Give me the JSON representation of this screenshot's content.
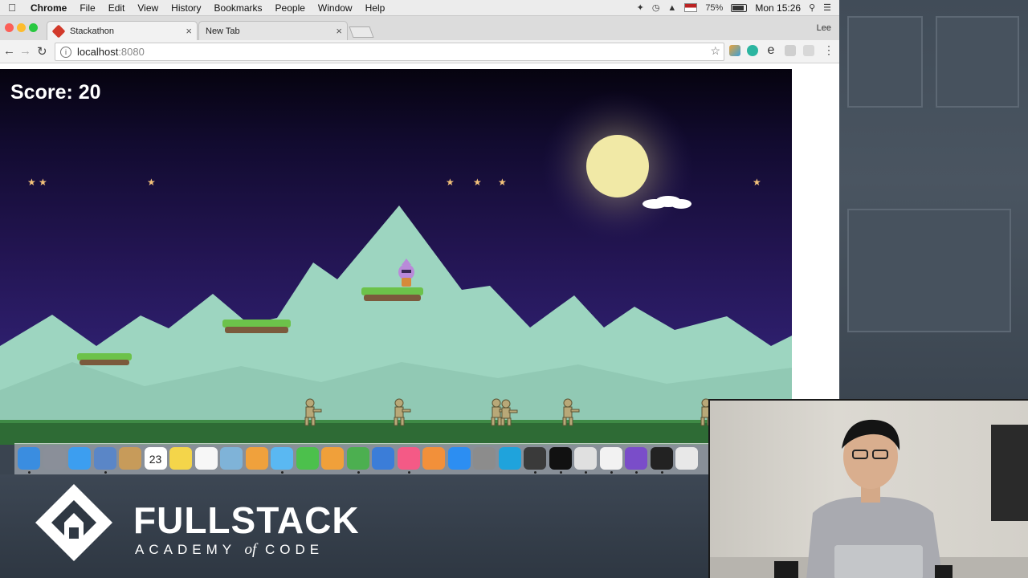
{
  "menubar": {
    "apple_icon": "apple-icon",
    "app_name": "Chrome",
    "items": [
      "File",
      "Edit",
      "View",
      "History",
      "Bookmarks",
      "People",
      "Window",
      "Help"
    ],
    "battery": "75%",
    "clock": "Mon 15:26"
  },
  "browser": {
    "tabs": [
      {
        "title": "Stackathon",
        "active": true
      },
      {
        "title": "New Tab",
        "active": false
      }
    ],
    "profile": "Lee",
    "url_host": "localhost",
    "url_port": ":8080"
  },
  "game": {
    "score_label": "Score: 20",
    "colors": {
      "sky_top": "#06030f",
      "sky_bottom": "#3a2a82",
      "mountain": "#9dd5c0",
      "grass": "#2e6b35",
      "moon": "#f1e9a6"
    }
  },
  "dock": {
    "icons": [
      "finder-icon",
      "launchpad-icon",
      "safari-icon",
      "mail-icon",
      "contacts-icon",
      "calendar-icon",
      "notes-icon",
      "reminders-icon",
      "preview-icon",
      "photos-icon",
      "messages-icon",
      "facetime-icon",
      "pages-icon",
      "numbers-icon",
      "keynote-icon",
      "itunes-icon",
      "ibooks-icon",
      "app-store-icon",
      "system-preferences-icon",
      "skype-icon",
      "sublime-icon",
      "terminal-icon",
      "chrome-icon",
      "slack-icon",
      "pen-icon",
      "activity-monitor-icon",
      "printer-icon"
    ],
    "calendar_day": "23"
  },
  "branding": {
    "title": "FULLSTACK",
    "subtitle_before": "ACADEMY ",
    "subtitle_of": "of",
    "subtitle_after": " CODE"
  }
}
